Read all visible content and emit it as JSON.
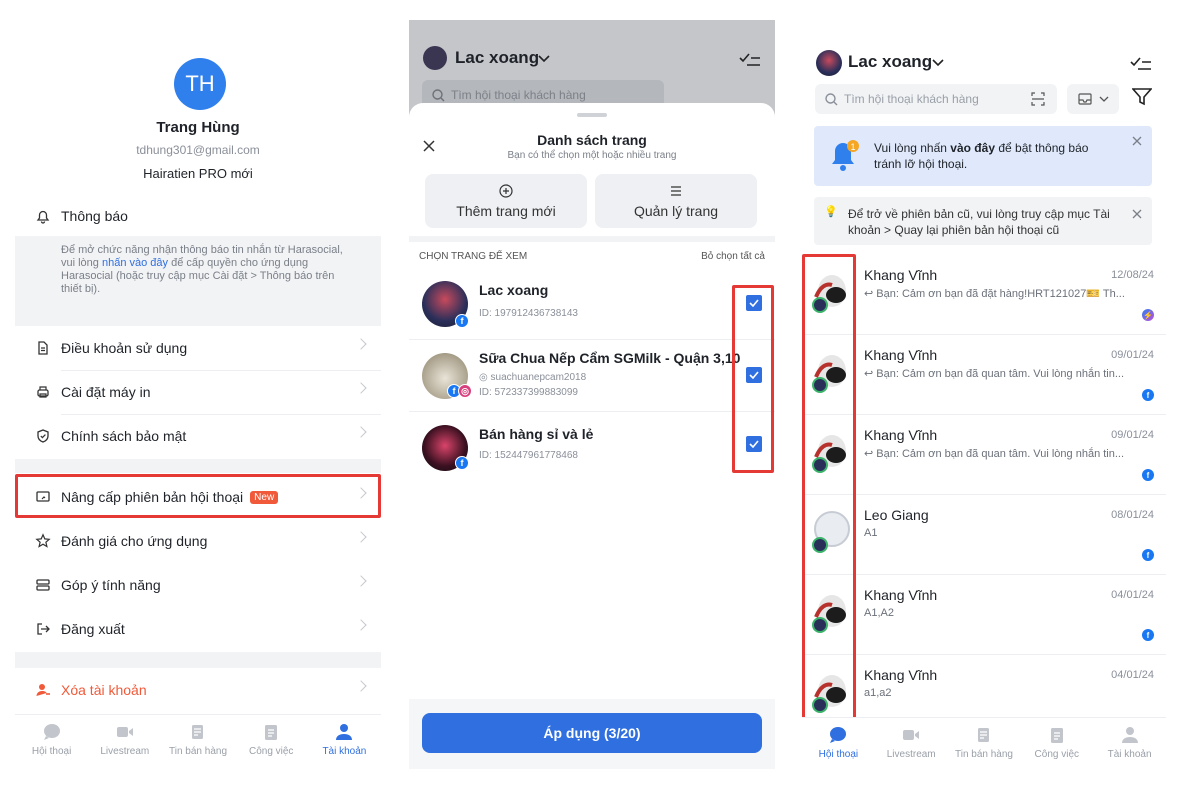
{
  "panel1": {
    "avatar_initials": "TH",
    "user_name": "Trang Hùng",
    "email": "tdhung301@gmail.com",
    "plan": "Hairatien PRO mới",
    "notifications_label": "Thông báo",
    "notice_text_1": "Để mở chức năng nhận thông báo tin nhắn từ Harasocial, vui lòng ",
    "notice_link": "nhấn vào đây",
    "notice_text_2": " để cấp quyền cho ứng dụng Harasocial (hoặc truy cập mục Cài đặt > Thông báo trên thiết bị).",
    "menu": {
      "terms": "Điều khoản sử dụng",
      "printer": "Cài đặt máy in",
      "privacy": "Chính sách bảo mật",
      "upgrade": "Nâng cấp phiên bản hội thoại",
      "upgrade_badge": "New",
      "rate": "Đánh giá cho ứng dụng",
      "feedback": "Góp ý tính năng",
      "logout": "Đăng xuất",
      "delete_account": "Xóa tài khoản"
    },
    "tabs": [
      "Hội thoại",
      "Livestream",
      "Tin bán hàng",
      "Công việc",
      "Tài khoản"
    ]
  },
  "panel2": {
    "page_name": "Lac xoang",
    "search_placeholder": "Tìm hội thoại khách hàng",
    "sheet_title": "Danh sách trang",
    "sheet_subtitle": "Bạn có thể chọn một hoặc nhiều trang",
    "add_page": "Thêm trang mới",
    "manage_page": "Quản lý trang",
    "choose_label": "CHỌN TRANG ĐỂ XEM",
    "deselect_all": "Bỏ chọn tất cả",
    "pages": [
      {
        "name": "Lac xoang",
        "sub": "",
        "id": "ID: 197912436738143"
      },
      {
        "name": "Sữa Chua Nếp Cẩm SGMilk - Quận 3,10",
        "sub": "suachuanepcam2018",
        "id": "ID: 572337399883099"
      },
      {
        "name": "Bán hàng sỉ và lẻ",
        "sub": "",
        "id": "ID: 152447961778468"
      }
    ],
    "apply": "Áp dụng (3/20)"
  },
  "panel3": {
    "page_name": "Lac xoang",
    "search_placeholder": "Tìm hội thoại khách hàng",
    "banner_text_1": "Vui lòng nhấn ",
    "banner_bold": "vào đây",
    "banner_text_2": " để bật thông báo tránh lỡ hội thoại.",
    "old_version_text": "Để trở về phiên bản cũ, vui lòng truy cập mục Tài khoản > Quay lại phiên bản hội thoại cũ",
    "conversations": [
      {
        "name": "Khang Vĩnh",
        "date": "12/08/24",
        "msg": "Bạn: Cảm ơn bạn đã đặt hàng!HRT121027🎫 Th...",
        "channel": "messenger"
      },
      {
        "name": "Khang Vĩnh",
        "date": "09/01/24",
        "msg": "Bạn: Cảm ơn bạn đã quan tâm. Vui lòng nhắn tin...",
        "channel": "facebook"
      },
      {
        "name": "Khang Vĩnh",
        "date": "09/01/24",
        "msg": "Bạn: Cảm ơn bạn đã quan tâm. Vui lòng nhắn tin...",
        "channel": "facebook"
      },
      {
        "name": "Leo Giang",
        "date": "08/01/24",
        "msg": "A1",
        "channel": "facebook"
      },
      {
        "name": "Khang Vĩnh",
        "date": "04/01/24",
        "msg": "A1,A2",
        "channel": "facebook"
      },
      {
        "name": "Khang Vĩnh",
        "date": "04/01/24",
        "msg": "a1,a2",
        "channel": "facebook"
      }
    ],
    "tabs": [
      "Hội thoại",
      "Livestream",
      "Tin bán hàng",
      "Công việc",
      "Tài khoản"
    ]
  },
  "colors": {
    "accent": "#2f6fe0",
    "highlight": "#e53935",
    "danger": "#f05a3a"
  }
}
